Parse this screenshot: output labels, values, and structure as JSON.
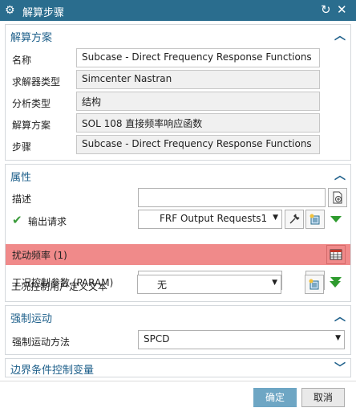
{
  "titlebar": {
    "title": "解算步骤"
  },
  "solution_panel": {
    "title": "解算方案",
    "rows": [
      {
        "label": "名称",
        "value": "Subcase - Direct Frequency Response Functions"
      },
      {
        "label": "求解器类型",
        "value": "Simcenter Nastran"
      },
      {
        "label": "分析类型",
        "value": "结构"
      },
      {
        "label": "解算方案",
        "value": "SOL 108 直接频率响应函数"
      },
      {
        "label": "步骤",
        "value": "Subcase - Direct Frequency Response Functions"
      }
    ]
  },
  "properties_panel": {
    "title": "属性",
    "description_label": "描述",
    "description_value": "",
    "output_request_label": "输出请求",
    "output_request_value": "FRF Output Requests1",
    "excitation_label": "扰动频率 (1)",
    "case_param_label": "工况控制参数 (PARAM)",
    "case_param_value": "无",
    "case_text_label": "工况控制用户定义文本",
    "case_text_value": "无"
  },
  "motion_panel": {
    "title": "强制运动",
    "method_label": "强制运动方法",
    "method_value": "SPCD"
  },
  "bc_panel": {
    "title": "边界条件控制变量"
  },
  "buttons": {
    "ok": "确定",
    "cancel": "取消"
  },
  "colors": {
    "titlebar": "#2a6d8e",
    "section_title": "#1d5f8a",
    "highlight": "#f08a8a",
    "check": "#3a9b3a",
    "ok_button": "#6ea6c4"
  }
}
